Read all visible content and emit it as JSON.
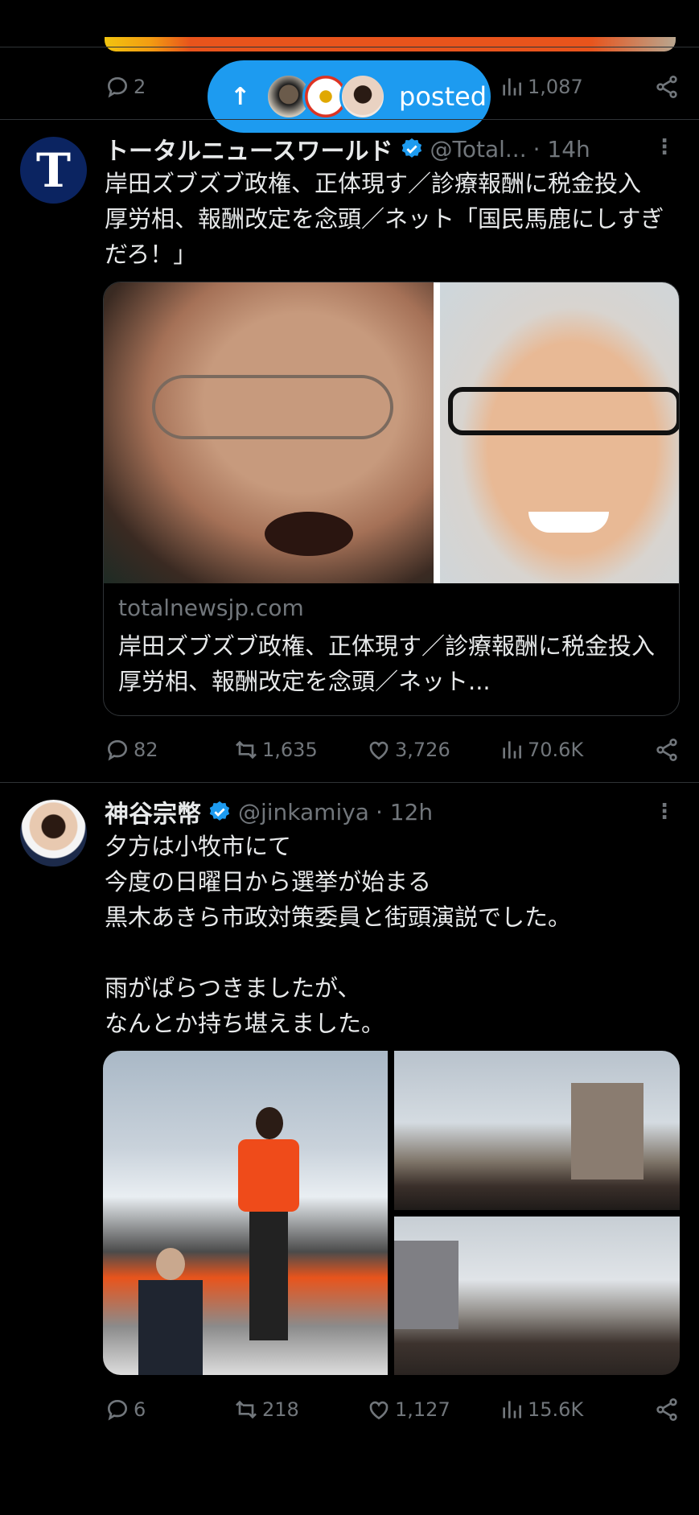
{
  "prev_tweet": {
    "stats": {
      "replies": "2",
      "views": "1,087"
    }
  },
  "new_posts_pill": {
    "arrow": "↑",
    "label": "posted"
  },
  "tweet1": {
    "author": "トータルニュースワールド",
    "handle": "@Total...",
    "time": "· 14h",
    "avatar_letter": "T",
    "text": "岸田ズブズブ政権、正体現す／診療報酬に税金投入　厚労相、報酬改定を念頭／ネット「国民馬鹿にしすぎだろ！」",
    "card": {
      "domain": "totalnewsjp.com",
      "title": "岸田ズブズブ政権、正体現す／診療報酬に税金投入　厚労相、報酬改定を念頭／ネット..."
    },
    "stats": {
      "replies": "82",
      "retweets": "1,635",
      "likes": "3,726",
      "views": "70.6K"
    }
  },
  "tweet2": {
    "author": "神谷宗幣",
    "handle": "@jinkamiya",
    "time": "· 12h",
    "text": "夕方は小牧市にて\n今度の日曜日から選挙が始まる\n黒木あきら市政対策委員と街頭演説でした。\n\n雨がぱらつきましたが、\nなんとか持ち堪えました。",
    "stats": {
      "replies": "6",
      "retweets": "218",
      "likes": "1,127",
      "views": "15.6K"
    }
  },
  "colors": {
    "accent": "#1d9bf0",
    "muted": "#71767b",
    "text": "#e7e9ea",
    "divider": "#2f3336"
  }
}
